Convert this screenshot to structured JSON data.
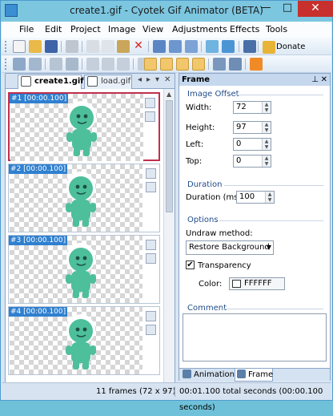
{
  "window": {
    "title": "create1.gif - Cyotek Gif Animator (BETA)",
    "min": "—",
    "max": "□",
    "close": "✕"
  },
  "menu": [
    "File",
    "Edit",
    "Project",
    "Image",
    "View",
    "Adjustments",
    "Effects",
    "Tools"
  ],
  "toolbar": {
    "donate_label": "Donate"
  },
  "doc_tabs": [
    {
      "label": "create1.gif",
      "active": true
    },
    {
      "label": "load.gif",
      "active": false
    }
  ],
  "frames": [
    {
      "label": "#1 [00:00.100]",
      "selected": true
    },
    {
      "label": "#2 [00:00.100]",
      "selected": false
    },
    {
      "label": "#3 [00:00.100]",
      "selected": false
    },
    {
      "label": "#4 [00:00.100]",
      "selected": false
    }
  ],
  "panel": {
    "title": "Frame",
    "image_offset": "Image Offset",
    "width_label": "Width:",
    "width_value": "72",
    "height_label": "Height:",
    "height_value": "97",
    "left_label": "Left:",
    "left_value": "0",
    "top_label": "Top:",
    "top_value": "0",
    "duration_group": "Duration",
    "duration_label": "Duration (ms):",
    "duration_value": "100",
    "options_group": "Options",
    "undraw_label": "Undraw method:",
    "undraw_value": "Restore Background",
    "transparency_label": "Transparency",
    "transparency_checked": true,
    "color_label": "Color:",
    "color_value": "FFFFFF",
    "comment_label": "Comment",
    "tabs": [
      "Animation",
      "Frame"
    ]
  },
  "status": {
    "frames": "11 frames (72 x 97)",
    "time": "00:01.100 total seconds (00:00.100 seconds)"
  },
  "colors": {
    "sprite": "#4dbf9a",
    "selection": "#c0304f",
    "frame_label_bg": "#2f80d0"
  }
}
